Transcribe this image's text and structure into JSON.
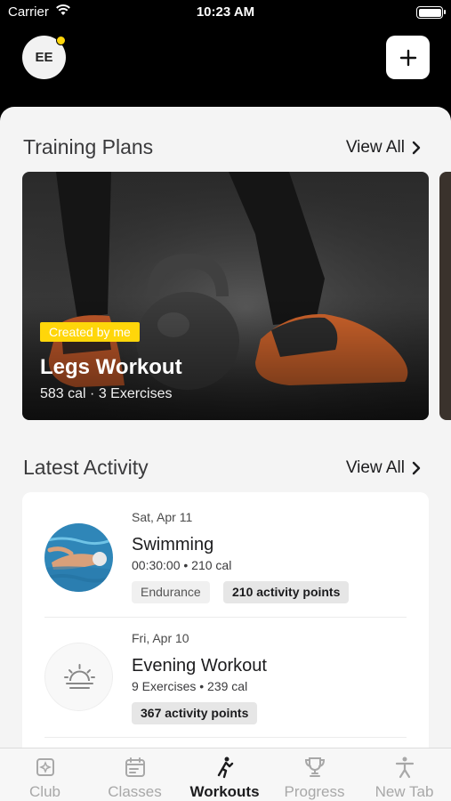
{
  "status_bar": {
    "carrier": "Carrier",
    "time": "10:23 AM"
  },
  "header": {
    "avatar_initials": "EE"
  },
  "training_plans": {
    "title": "Training Plans",
    "view_all": "View All",
    "cards": [
      {
        "badge": "Created by me",
        "title": "Legs Workout",
        "meta": "583 cal · 3 Exercises"
      }
    ]
  },
  "latest_activity": {
    "title": "Latest Activity",
    "view_all": "View All",
    "items": [
      {
        "date": "Sat, Apr 11",
        "name": "Swimming",
        "meta": "00:30:00 • 210 cal",
        "tags": [
          "Endurance",
          "210 activity points"
        ]
      },
      {
        "date": "Fri, Apr 10",
        "name": "Evening Workout",
        "meta": "9 Exercises • 239 cal",
        "tags": [
          "367 activity points"
        ]
      }
    ]
  },
  "tab_bar": {
    "tabs": [
      {
        "label": "Club",
        "icon": "club-icon"
      },
      {
        "label": "Classes",
        "icon": "classes-icon"
      },
      {
        "label": "Workouts",
        "icon": "workouts-icon",
        "active": true
      },
      {
        "label": "Progress",
        "icon": "trophy-icon"
      },
      {
        "label": "New Tab",
        "icon": "person-icon"
      }
    ]
  },
  "colors": {
    "accent": "#ffd60a",
    "background": "#000000",
    "sheet": "#f4f4f4"
  }
}
